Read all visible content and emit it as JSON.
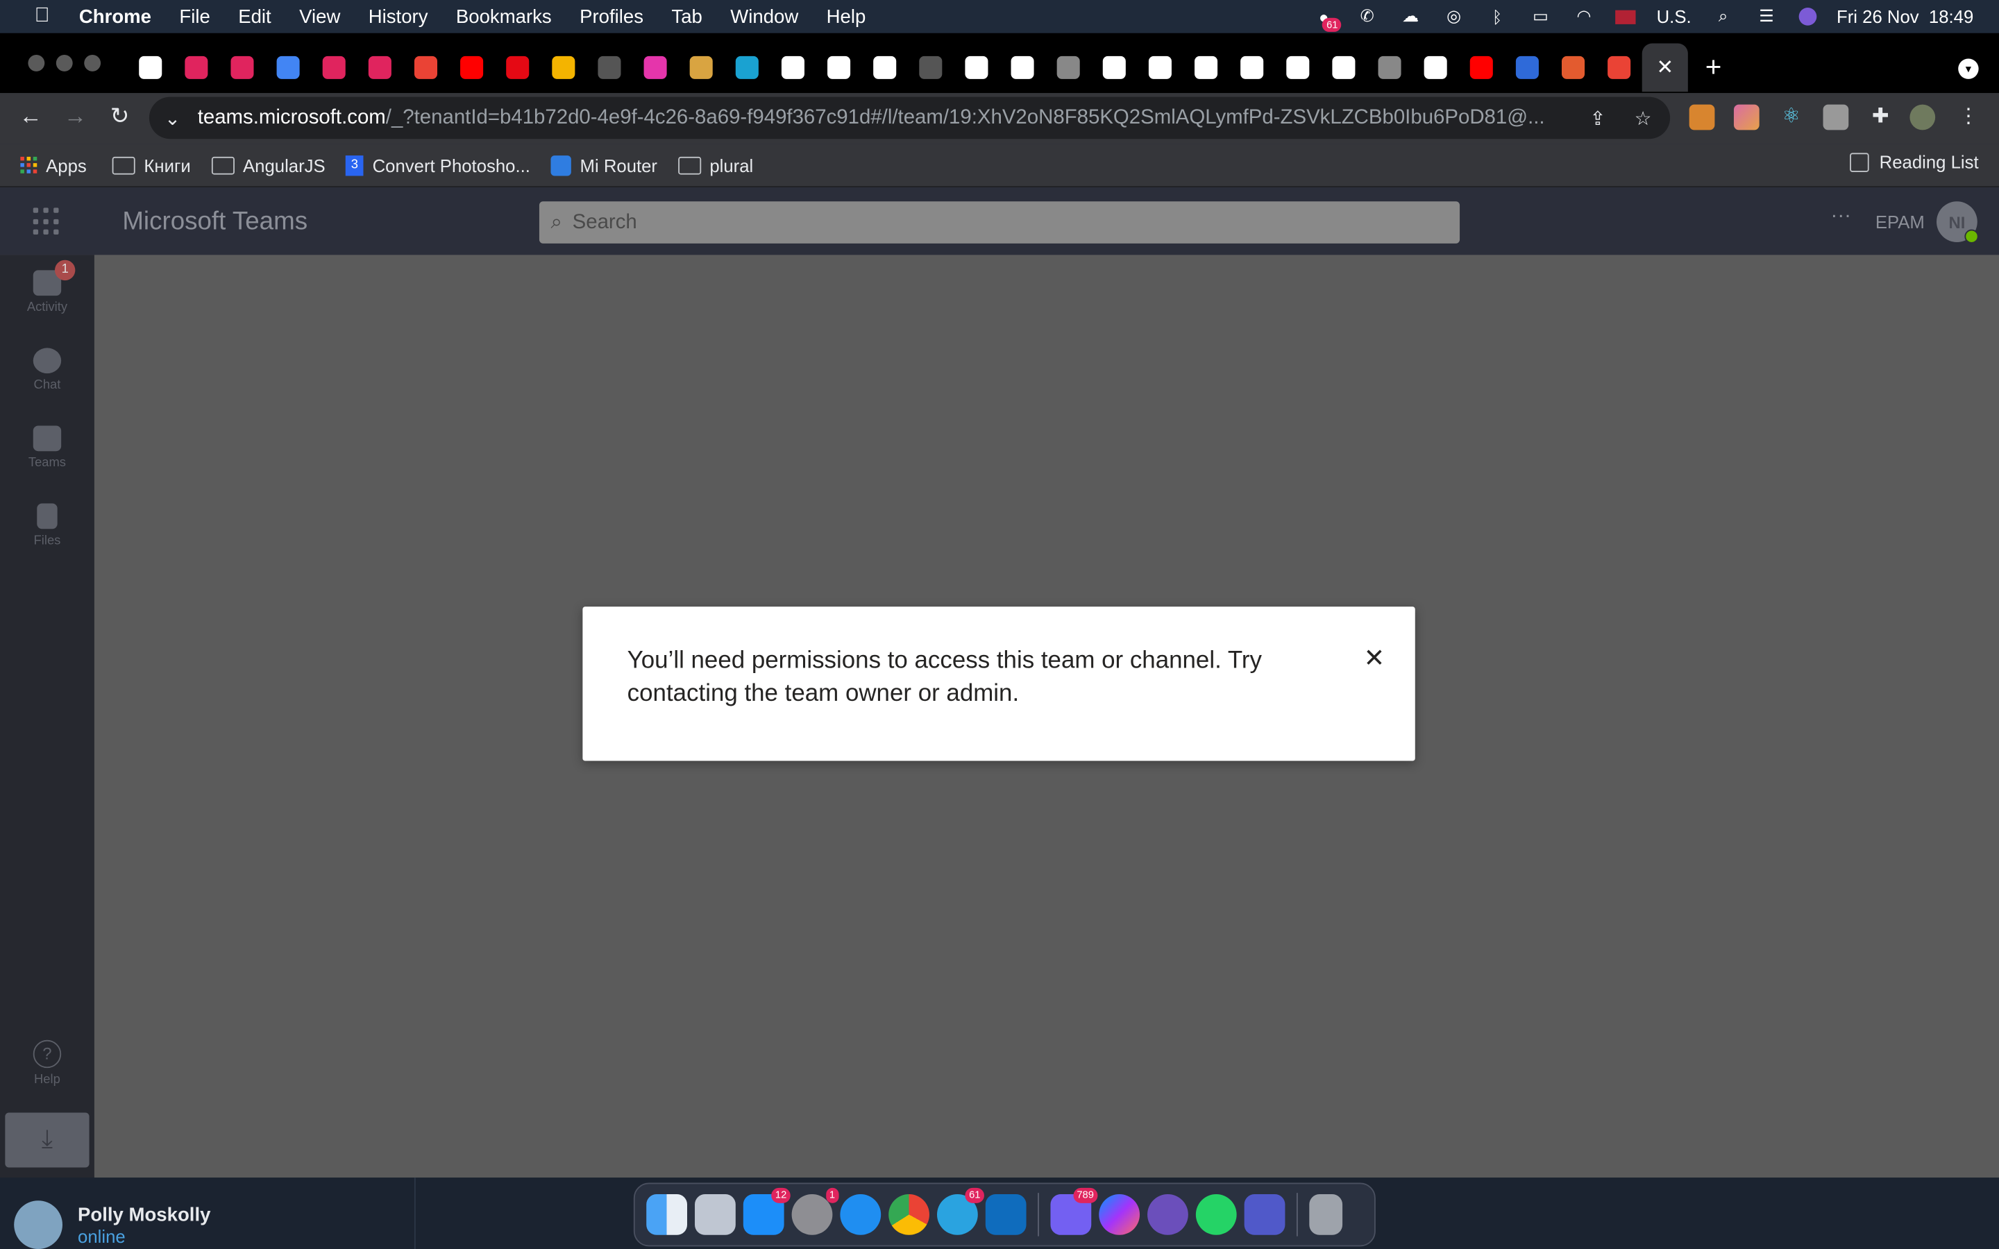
{
  "menubar": {
    "app": "Chrome",
    "items": [
      "File",
      "Edit",
      "View",
      "History",
      "Bookmarks",
      "Profiles",
      "Tab",
      "Window",
      "Help"
    ],
    "status": {
      "notif_badge": "61",
      "input_source": "U.S.",
      "datetime": "Fri 26 Nov  18:49"
    }
  },
  "browser": {
    "url_host": "teams.microsoft.com",
    "url_path": "/_?tenantId=b41b72d0-4e9f-4c26-8a69-f949f367c91d#/l/team/19:XhV2oN8F85KQ2SmlAQLymfPd-ZSVkLZCBb0Ibu6PoD81@...",
    "tab_favicon_colors": [
      "#ffffff",
      "#e0245e",
      "#e0245e",
      "#4285f4",
      "#e0245e",
      "#e0245e",
      "#ea4335",
      "#ff0000",
      "#e50914",
      "#f4b400",
      "#555555",
      "#e535ab",
      "#d9a441",
      "#1aa2d1",
      "#ffffff",
      "#ffffff",
      "#ffffff",
      "#555555",
      "#ffffff",
      "#ffffff",
      "#888888",
      "#ffffff",
      "#ffffff",
      "#ffffff",
      "#ffffff",
      "#ffffff",
      "#ffffff",
      "#888888",
      "#ffffff",
      "#ff0000",
      "#2f6ad9",
      "#e35b2f",
      "#ea4335"
    ],
    "bookmarks": [
      {
        "label": "Apps",
        "icon": "apps-grid-icon"
      },
      {
        "label": "Книги",
        "icon": "folder-icon"
      },
      {
        "label": "AngularJS",
        "icon": "folder-icon"
      },
      {
        "label": "Convert Photosho...",
        "icon": "css3-icon"
      },
      {
        "label": "Mi Router",
        "icon": "wifi-icon"
      },
      {
        "label": "plural",
        "icon": "folder-icon"
      }
    ],
    "reading_list": "Reading List"
  },
  "teams": {
    "title": "Microsoft Teams",
    "search_placeholder": "Search",
    "more": "···",
    "org": "EPAM",
    "avatar_initials": "NI",
    "rail": {
      "activity": "Activity",
      "activity_badge": "1",
      "chat": "Chat",
      "teams": "Teams",
      "files": "Files",
      "help": "Help"
    }
  },
  "dialog": {
    "message": "You’ll need permissions to access this team or channel. Try contacting the team owner or admin.",
    "close_glyph": "✕"
  },
  "viber": {
    "user_name": "Polly Moskolly",
    "status": "online"
  },
  "dock": {
    "badges": {
      "appstore": "12",
      "settings": "1",
      "telegram": "61",
      "viber": "789"
    }
  }
}
